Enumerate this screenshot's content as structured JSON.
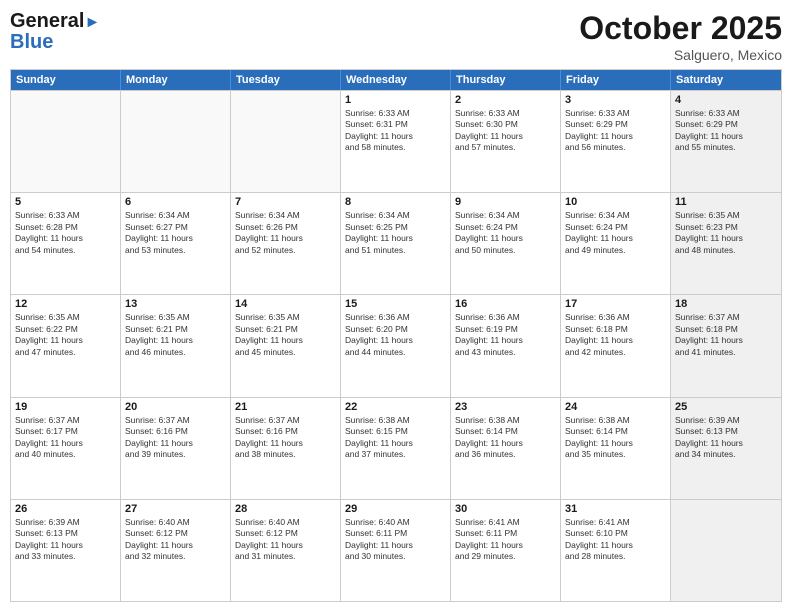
{
  "header": {
    "logo_line1": "General",
    "logo_line2": "Blue",
    "month": "October 2025",
    "location": "Salguero, Mexico"
  },
  "weekdays": [
    "Sunday",
    "Monday",
    "Tuesday",
    "Wednesday",
    "Thursday",
    "Friday",
    "Saturday"
  ],
  "rows": [
    [
      {
        "day": "",
        "text": "",
        "empty": true
      },
      {
        "day": "",
        "text": "",
        "empty": true
      },
      {
        "day": "",
        "text": "",
        "empty": true
      },
      {
        "day": "1",
        "text": "Sunrise: 6:33 AM\nSunset: 6:31 PM\nDaylight: 11 hours\nand 58 minutes."
      },
      {
        "day": "2",
        "text": "Sunrise: 6:33 AM\nSunset: 6:30 PM\nDaylight: 11 hours\nand 57 minutes."
      },
      {
        "day": "3",
        "text": "Sunrise: 6:33 AM\nSunset: 6:29 PM\nDaylight: 11 hours\nand 56 minutes."
      },
      {
        "day": "4",
        "text": "Sunrise: 6:33 AM\nSunset: 6:29 PM\nDaylight: 11 hours\nand 55 minutes.",
        "shaded": true
      }
    ],
    [
      {
        "day": "5",
        "text": "Sunrise: 6:33 AM\nSunset: 6:28 PM\nDaylight: 11 hours\nand 54 minutes."
      },
      {
        "day": "6",
        "text": "Sunrise: 6:34 AM\nSunset: 6:27 PM\nDaylight: 11 hours\nand 53 minutes."
      },
      {
        "day": "7",
        "text": "Sunrise: 6:34 AM\nSunset: 6:26 PM\nDaylight: 11 hours\nand 52 minutes."
      },
      {
        "day": "8",
        "text": "Sunrise: 6:34 AM\nSunset: 6:25 PM\nDaylight: 11 hours\nand 51 minutes."
      },
      {
        "day": "9",
        "text": "Sunrise: 6:34 AM\nSunset: 6:24 PM\nDaylight: 11 hours\nand 50 minutes."
      },
      {
        "day": "10",
        "text": "Sunrise: 6:34 AM\nSunset: 6:24 PM\nDaylight: 11 hours\nand 49 minutes."
      },
      {
        "day": "11",
        "text": "Sunrise: 6:35 AM\nSunset: 6:23 PM\nDaylight: 11 hours\nand 48 minutes.",
        "shaded": true
      }
    ],
    [
      {
        "day": "12",
        "text": "Sunrise: 6:35 AM\nSunset: 6:22 PM\nDaylight: 11 hours\nand 47 minutes."
      },
      {
        "day": "13",
        "text": "Sunrise: 6:35 AM\nSunset: 6:21 PM\nDaylight: 11 hours\nand 46 minutes."
      },
      {
        "day": "14",
        "text": "Sunrise: 6:35 AM\nSunset: 6:21 PM\nDaylight: 11 hours\nand 45 minutes."
      },
      {
        "day": "15",
        "text": "Sunrise: 6:36 AM\nSunset: 6:20 PM\nDaylight: 11 hours\nand 44 minutes."
      },
      {
        "day": "16",
        "text": "Sunrise: 6:36 AM\nSunset: 6:19 PM\nDaylight: 11 hours\nand 43 minutes."
      },
      {
        "day": "17",
        "text": "Sunrise: 6:36 AM\nSunset: 6:18 PM\nDaylight: 11 hours\nand 42 minutes."
      },
      {
        "day": "18",
        "text": "Sunrise: 6:37 AM\nSunset: 6:18 PM\nDaylight: 11 hours\nand 41 minutes.",
        "shaded": true
      }
    ],
    [
      {
        "day": "19",
        "text": "Sunrise: 6:37 AM\nSunset: 6:17 PM\nDaylight: 11 hours\nand 40 minutes."
      },
      {
        "day": "20",
        "text": "Sunrise: 6:37 AM\nSunset: 6:16 PM\nDaylight: 11 hours\nand 39 minutes."
      },
      {
        "day": "21",
        "text": "Sunrise: 6:37 AM\nSunset: 6:16 PM\nDaylight: 11 hours\nand 38 minutes."
      },
      {
        "day": "22",
        "text": "Sunrise: 6:38 AM\nSunset: 6:15 PM\nDaylight: 11 hours\nand 37 minutes."
      },
      {
        "day": "23",
        "text": "Sunrise: 6:38 AM\nSunset: 6:14 PM\nDaylight: 11 hours\nand 36 minutes."
      },
      {
        "day": "24",
        "text": "Sunrise: 6:38 AM\nSunset: 6:14 PM\nDaylight: 11 hours\nand 35 minutes."
      },
      {
        "day": "25",
        "text": "Sunrise: 6:39 AM\nSunset: 6:13 PM\nDaylight: 11 hours\nand 34 minutes.",
        "shaded": true
      }
    ],
    [
      {
        "day": "26",
        "text": "Sunrise: 6:39 AM\nSunset: 6:13 PM\nDaylight: 11 hours\nand 33 minutes."
      },
      {
        "day": "27",
        "text": "Sunrise: 6:40 AM\nSunset: 6:12 PM\nDaylight: 11 hours\nand 32 minutes."
      },
      {
        "day": "28",
        "text": "Sunrise: 6:40 AM\nSunset: 6:12 PM\nDaylight: 11 hours\nand 31 minutes."
      },
      {
        "day": "29",
        "text": "Sunrise: 6:40 AM\nSunset: 6:11 PM\nDaylight: 11 hours\nand 30 minutes."
      },
      {
        "day": "30",
        "text": "Sunrise: 6:41 AM\nSunset: 6:11 PM\nDaylight: 11 hours\nand 29 minutes."
      },
      {
        "day": "31",
        "text": "Sunrise: 6:41 AM\nSunset: 6:10 PM\nDaylight: 11 hours\nand 28 minutes."
      },
      {
        "day": "",
        "text": "",
        "empty": true,
        "shaded": true
      }
    ]
  ]
}
